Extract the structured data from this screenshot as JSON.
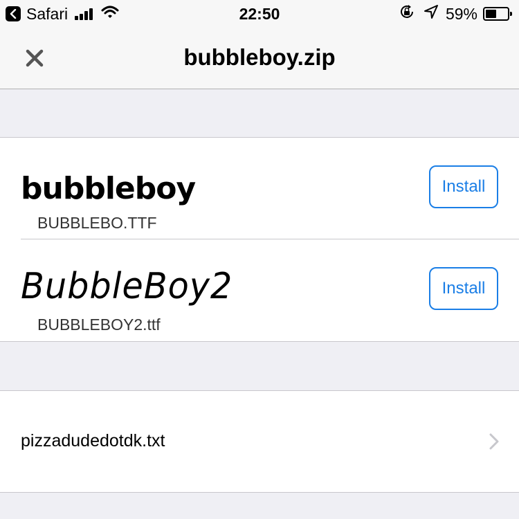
{
  "status_bar": {
    "back_app": "Safari",
    "time": "22:50",
    "battery_percent": "59%",
    "battery_level": 0.59
  },
  "nav": {
    "title": "bubbleboy.zip",
    "close_icon": "close-icon"
  },
  "fonts": [
    {
      "preview": "bubbleboy",
      "file": "BUBBLEBO.TTF",
      "button": "Install"
    },
    {
      "preview": "BubbleBoy2",
      "file": "BUBBLEBOY2.ttf",
      "button": "Install"
    }
  ],
  "files": [
    {
      "name": "pizzadudedotdk.txt",
      "icon": "chevron-right-icon"
    }
  ],
  "colors": {
    "accent": "#1a7ee6",
    "background": "#efeff4",
    "bar": "#f7f7f7"
  }
}
